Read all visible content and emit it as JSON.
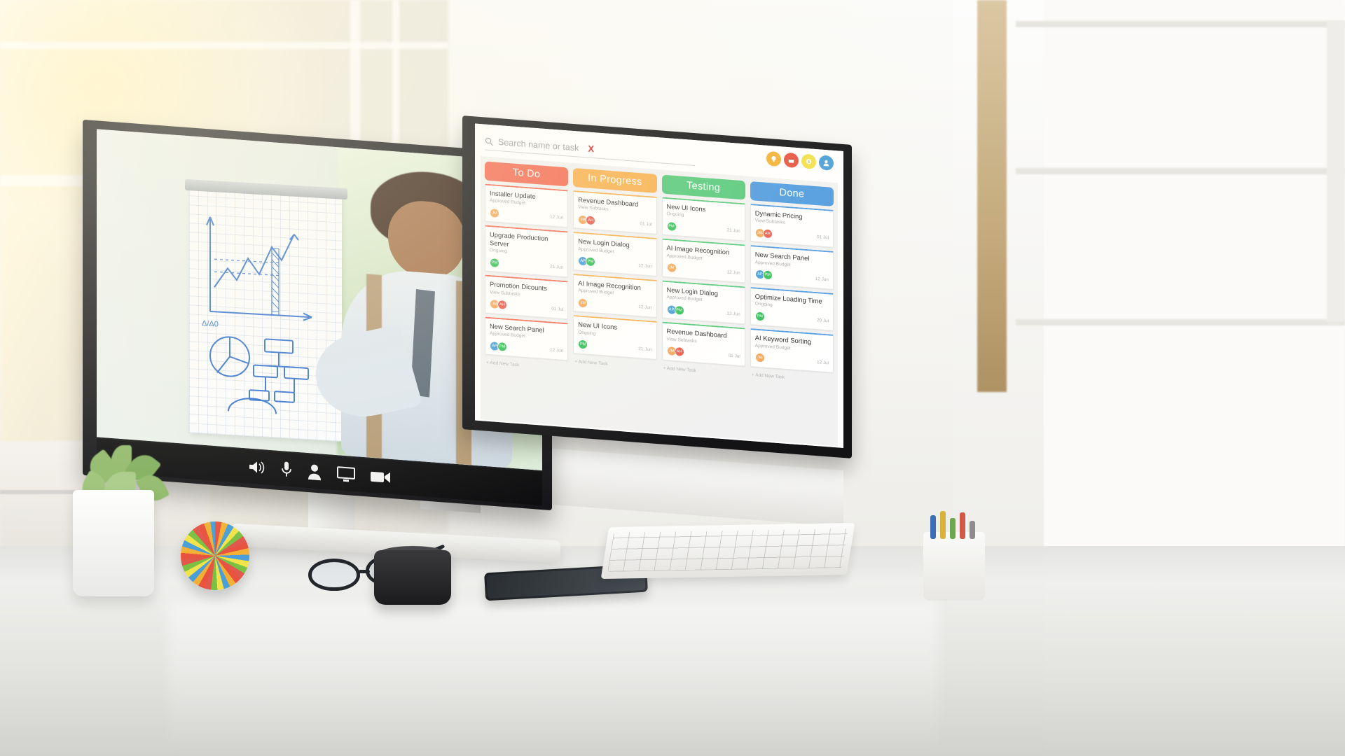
{
  "search": {
    "placeholder": "Search name or task",
    "clear_label": "X",
    "icon": "search-icon"
  },
  "toolbar": {
    "icons": [
      {
        "name": "idea-icon",
        "glyph": "●",
        "color": "#F2B134"
      },
      {
        "name": "calendar-icon",
        "glyph": "■",
        "color": "#E8533F"
      },
      {
        "name": "money-icon",
        "glyph": "●",
        "color": "#F2DF4B"
      },
      {
        "name": "profile-icon",
        "glyph": "●",
        "color": "#4A9FD8"
      }
    ]
  },
  "board": {
    "add_task_label": "+ Add New Task",
    "columns": [
      {
        "title": "To Do",
        "color": "#F36A52",
        "cards": [
          {
            "title": "Installer Update",
            "subtitle": "Approved Budget",
            "date": "12 Jun",
            "avatars": [
              {
                "initials": "JM",
                "color": "#F5A85C"
              }
            ]
          },
          {
            "title": "Upgrade Production Server",
            "subtitle": "Ongoing",
            "date": "21 Jun",
            "avatars": [
              {
                "initials": "PM",
                "color": "#35C05A"
              }
            ]
          },
          {
            "title": "Promotion Dicounts",
            "subtitle": "View Subtasks",
            "date": "01 Jul",
            "avatars": [
              {
                "initials": "JM",
                "color": "#F5A85C"
              },
              {
                "initials": "AH",
                "color": "#EC5B4E"
              }
            ]
          },
          {
            "title": "New Search Panel",
            "subtitle": "Approved Budget",
            "date": "12 Jun",
            "avatars": [
              {
                "initials": "AP",
                "color": "#4A9FD8"
              },
              {
                "initials": "PM",
                "color": "#35C05A"
              }
            ]
          }
        ]
      },
      {
        "title": "In Progress",
        "color": "#F8B04F",
        "cards": [
          {
            "title": "Revenue Dashboard",
            "subtitle": "View Subtasks",
            "date": "01 Jul",
            "avatars": [
              {
                "initials": "JM",
                "color": "#F5A85C"
              },
              {
                "initials": "AH",
                "color": "#EC5B4E"
              }
            ]
          },
          {
            "title": "New Login Dialog",
            "subtitle": "Approved Budget",
            "date": "12 Jun",
            "avatars": [
              {
                "initials": "AP",
                "color": "#4A9FD8"
              },
              {
                "initials": "PM",
                "color": "#35C05A"
              }
            ]
          },
          {
            "title": "AI Image Recognition",
            "subtitle": "Approved Budget",
            "date": "12 Jun",
            "avatars": [
              {
                "initials": "JM",
                "color": "#F5A85C"
              }
            ]
          },
          {
            "title": "New UI Icons",
            "subtitle": "Ongoing",
            "date": "21 Jun",
            "avatars": [
              {
                "initials": "PM",
                "color": "#35C05A"
              }
            ]
          }
        ]
      },
      {
        "title": "Testing",
        "color": "#55C97B",
        "cards": [
          {
            "title": "New UI Icons",
            "subtitle": "Ongoing",
            "date": "21 Jun",
            "avatars": [
              {
                "initials": "PM",
                "color": "#35C05A"
              }
            ]
          },
          {
            "title": "AI Image Recognition",
            "subtitle": "Approved Budget",
            "date": "12 Jun",
            "avatars": [
              {
                "initials": "JM",
                "color": "#F5A85C"
              }
            ]
          },
          {
            "title": "New Login Dialog",
            "subtitle": "Approved Budget",
            "date": "12 Jun",
            "avatars": [
              {
                "initials": "AP",
                "color": "#4A9FD8"
              },
              {
                "initials": "PM",
                "color": "#35C05A"
              }
            ]
          },
          {
            "title": "Revenue Dashboard",
            "subtitle": "View Subtasks",
            "date": "01 Jul",
            "avatars": [
              {
                "initials": "JM",
                "color": "#F5A85C"
              },
              {
                "initials": "AH",
                "color": "#EC5B4E"
              }
            ]
          }
        ]
      },
      {
        "title": "Done",
        "color": "#4E9BE0",
        "cards": [
          {
            "title": "Dynamic Pricing",
            "subtitle": "View Subtasks",
            "date": "01 Jul",
            "avatars": [
              {
                "initials": "JM",
                "color": "#F5A85C"
              },
              {
                "initials": "AH",
                "color": "#EC5B4E"
              }
            ]
          },
          {
            "title": "New Search Panel",
            "subtitle": "Approved Budget",
            "date": "12 Jun",
            "avatars": [
              {
                "initials": "AP",
                "color": "#4A9FD8"
              },
              {
                "initials": "PM",
                "color": "#35C05A"
              }
            ]
          },
          {
            "title": "Optimize Loading Time",
            "subtitle": "Ongoing",
            "date": "20 Jul",
            "avatars": [
              {
                "initials": "PM",
                "color": "#35C05A"
              }
            ]
          },
          {
            "title": "AI Keyword Sorting",
            "subtitle": "Approved Budget",
            "date": "12 Jul",
            "avatars": [
              {
                "initials": "JM",
                "color": "#F5A85C"
              }
            ]
          }
        ]
      }
    ]
  },
  "video_call": {
    "controls": [
      {
        "name": "volume-icon",
        "glyph": "🔊"
      },
      {
        "name": "microphone-icon",
        "glyph": "🎤"
      },
      {
        "name": "participant-icon",
        "glyph": "👤"
      },
      {
        "name": "screen-share-icon",
        "glyph": "🖵"
      },
      {
        "name": "camera-icon",
        "glyph": "🎥"
      }
    ]
  },
  "monitor": {
    "brand_text": "· · · · · ·"
  }
}
